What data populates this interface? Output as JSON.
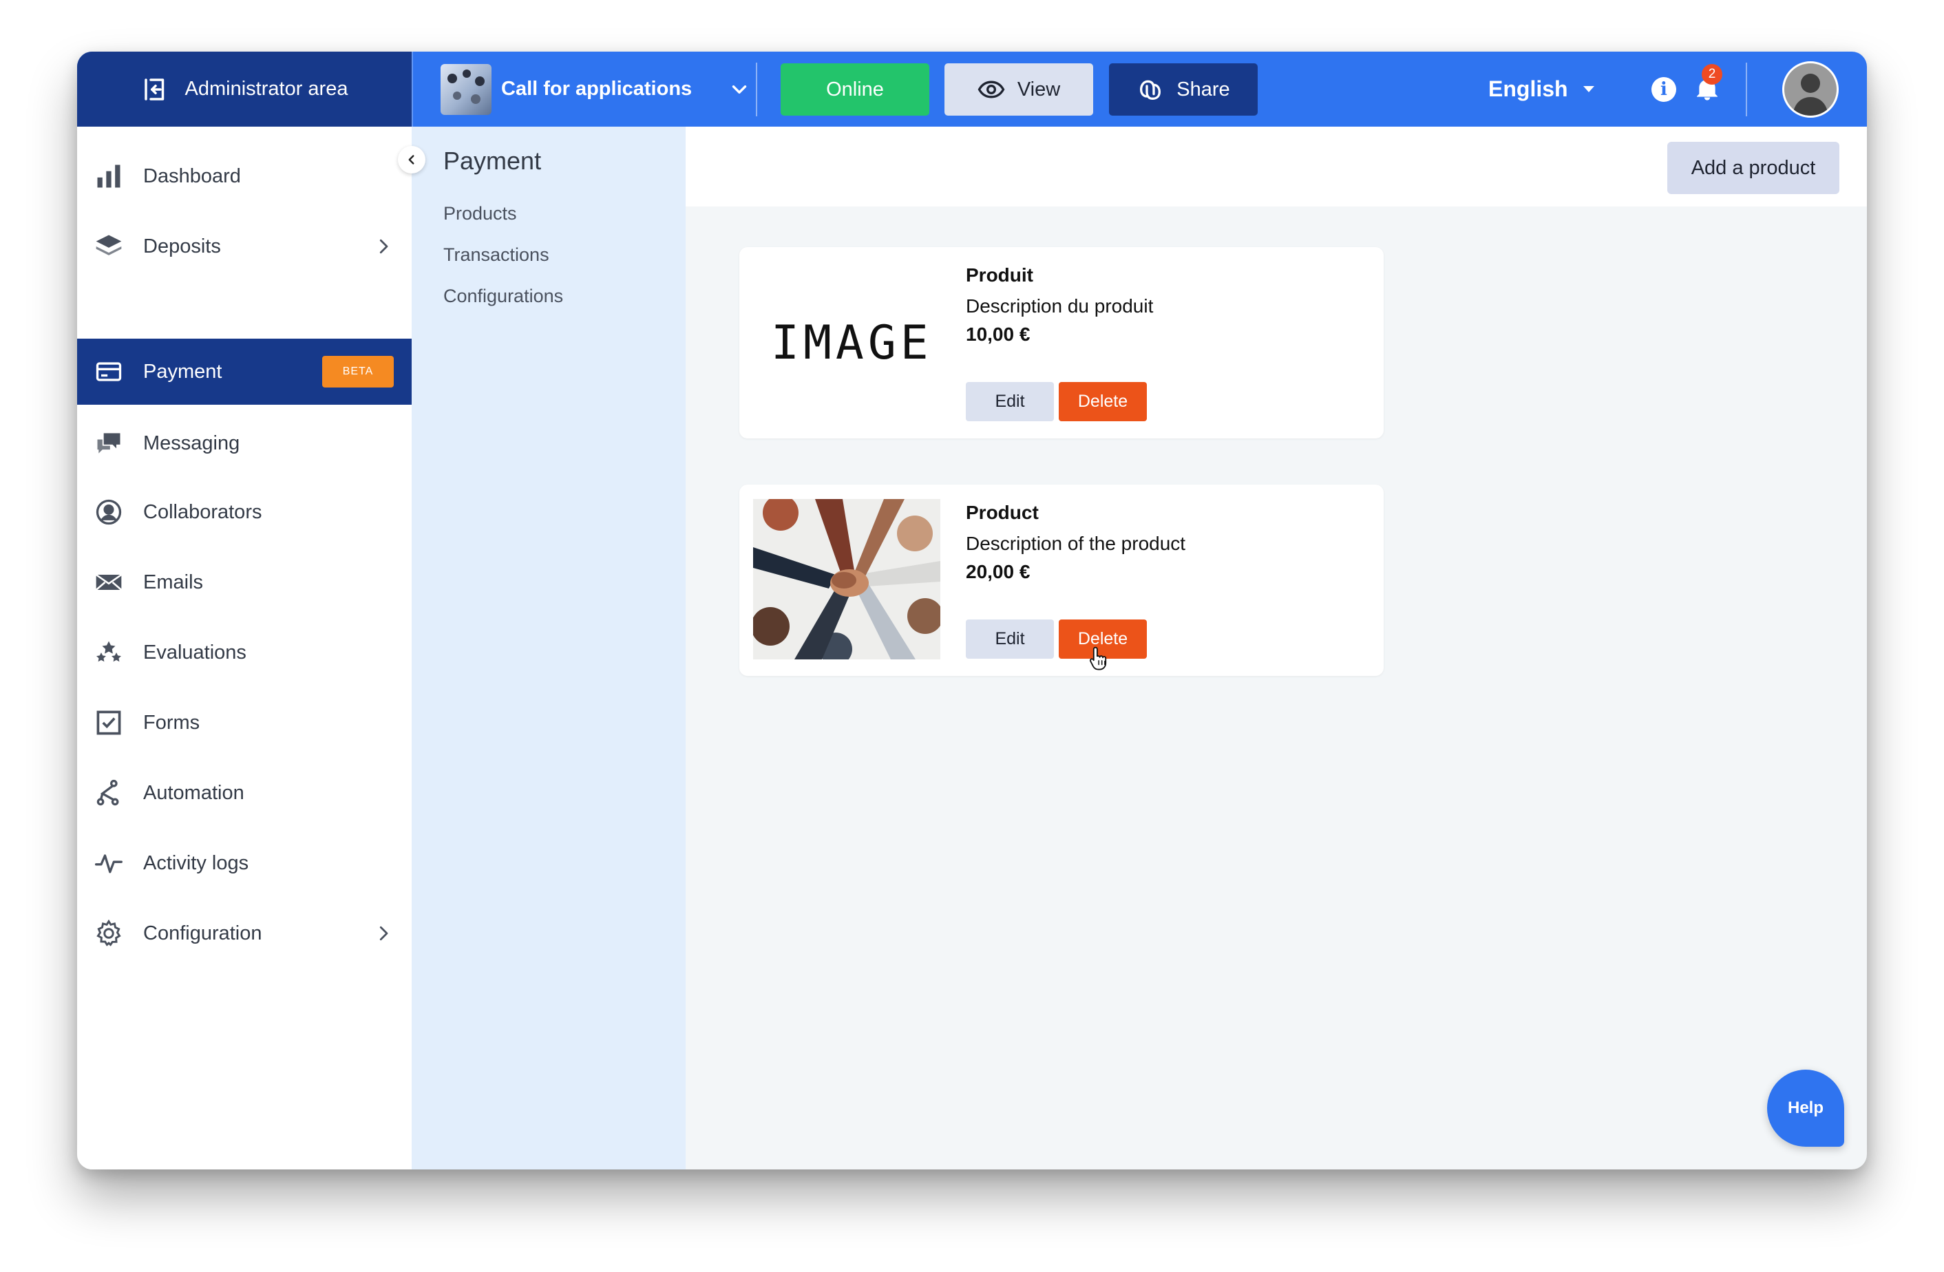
{
  "topbar": {
    "admin_label": "Administrator area",
    "project_title": "Call for applications",
    "online_label": "Online",
    "view_label": "View",
    "share_label": "Share",
    "language": "English",
    "notification_count": "2",
    "info_glyph": "i"
  },
  "sidebar": {
    "items": [
      {
        "label": "Dashboard",
        "icon": "bar-chart-icon"
      },
      {
        "label": "Deposits",
        "icon": "layers-icon"
      },
      {
        "label": "Payment",
        "icon": "credit-card-icon",
        "badge": "BETA"
      },
      {
        "label": "Messaging",
        "icon": "chat-bubbles-icon"
      },
      {
        "label": "Collaborators",
        "icon": "user-circle-icon"
      },
      {
        "label": "Emails",
        "icon": "envelope-icon"
      },
      {
        "label": "Evaluations",
        "icon": "stars-icon"
      },
      {
        "label": "Forms",
        "icon": "checkbox-icon"
      },
      {
        "label": "Automation",
        "icon": "flow-icon"
      },
      {
        "label": "Activity logs",
        "icon": "pulse-icon"
      },
      {
        "label": "Configuration",
        "icon": "gear-icon"
      }
    ]
  },
  "subnav": {
    "title": "Payment",
    "links": [
      "Products",
      "Transactions",
      "Configurations"
    ]
  },
  "main": {
    "add_product_label": "Add a product",
    "products": [
      {
        "image_text": "IMAGE",
        "name": "Produit",
        "description": "Description du produit",
        "price": "10,00 €",
        "edit_label": "Edit",
        "delete_label": "Delete"
      },
      {
        "name": "Product",
        "description": "Description of the product",
        "price": "20,00 €",
        "edit_label": "Edit",
        "delete_label": "Delete"
      }
    ]
  },
  "help_label": "Help",
  "colors": {
    "topbar": "#2f74f0",
    "navy": "#17398a",
    "online": "#23c46b",
    "delete": "#ec5319",
    "beta": "#f58a22"
  }
}
